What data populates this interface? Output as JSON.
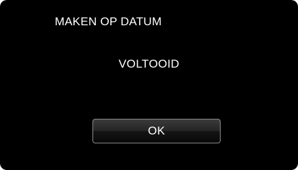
{
  "dialog": {
    "title": "MAKEN OP DATUM",
    "message": "VOLTOOID",
    "ok_label": "OK"
  },
  "colors": {
    "background": "#000000",
    "text": "#ffffff",
    "button_border": "#8d8d8d"
  }
}
